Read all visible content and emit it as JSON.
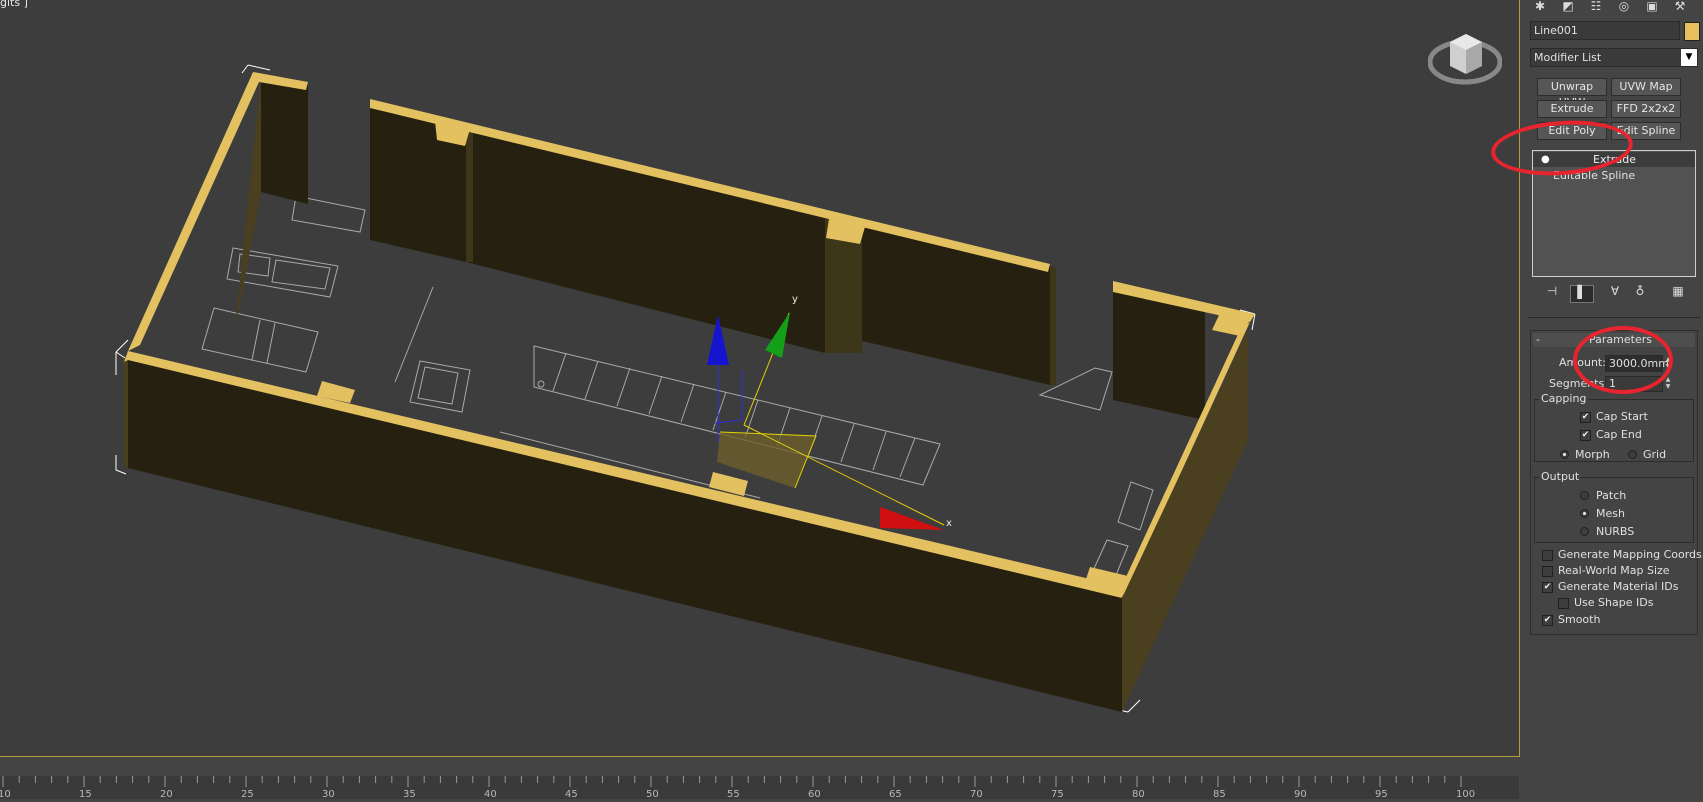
{
  "viewport": {
    "label": "gits ]"
  },
  "timeline": {
    "ticks": [
      "10",
      "15",
      "20",
      "25",
      "30",
      "35",
      "40",
      "45",
      "50",
      "55",
      "60",
      "65",
      "70",
      "75",
      "80",
      "85",
      "90",
      "95",
      "100"
    ]
  },
  "command_panel": {
    "tabs": [
      "create-icon",
      "modify-icon",
      "hierarchy-icon",
      "motion-icon",
      "display-icon",
      "utilities-icon"
    ],
    "object_name": "Line001",
    "object_color": "#e8c060",
    "modifier_list": "Modifier List",
    "modifier_buttons": [
      "Unwrap UVW",
      "UVW Map",
      "Extrude",
      "FFD 2x2x2",
      "Edit Poly",
      "Edit Spline"
    ],
    "stack": [
      "Extrude",
      "Editable Spline"
    ],
    "stack_tools": [
      "pin-stack-icon",
      "show-end-result-icon",
      "make-unique-icon",
      "remove-modifier-icon",
      "configure-sets-icon"
    ],
    "rollout_title": "Parameters",
    "rollout_toggle": "-",
    "amount_label": "Amount:",
    "amount_value": "3000.0mm",
    "segments_label": "Segments:",
    "segments_value": "1",
    "capping": {
      "title": "Capping",
      "cap_start": {
        "label": "Cap Start",
        "checked": true
      },
      "cap_end": {
        "label": "Cap End",
        "checked": true
      },
      "morph": {
        "label": "Morph",
        "selected": true
      },
      "grid": {
        "label": "Grid",
        "selected": false
      }
    },
    "output": {
      "title": "Output",
      "options": [
        {
          "label": "Patch",
          "selected": false
        },
        {
          "label": "Mesh",
          "selected": true
        },
        {
          "label": "NURBS",
          "selected": false
        }
      ]
    },
    "options": [
      {
        "label": "Generate Mapping Coords.",
        "checked": false
      },
      {
        "label": "Real-World Map Size",
        "checked": false
      },
      {
        "label": "Generate Material IDs",
        "checked": true
      },
      {
        "label": "Use Shape IDs",
        "checked": false
      },
      {
        "label": "Smooth",
        "checked": true
      }
    ]
  },
  "gizmo": {
    "x_label": "x",
    "y_label": "y"
  },
  "colors": {
    "wall_face": "#262010",
    "wall_top": "#e3c160",
    "selection": "#ffffff",
    "annotation": "#e8252e"
  }
}
